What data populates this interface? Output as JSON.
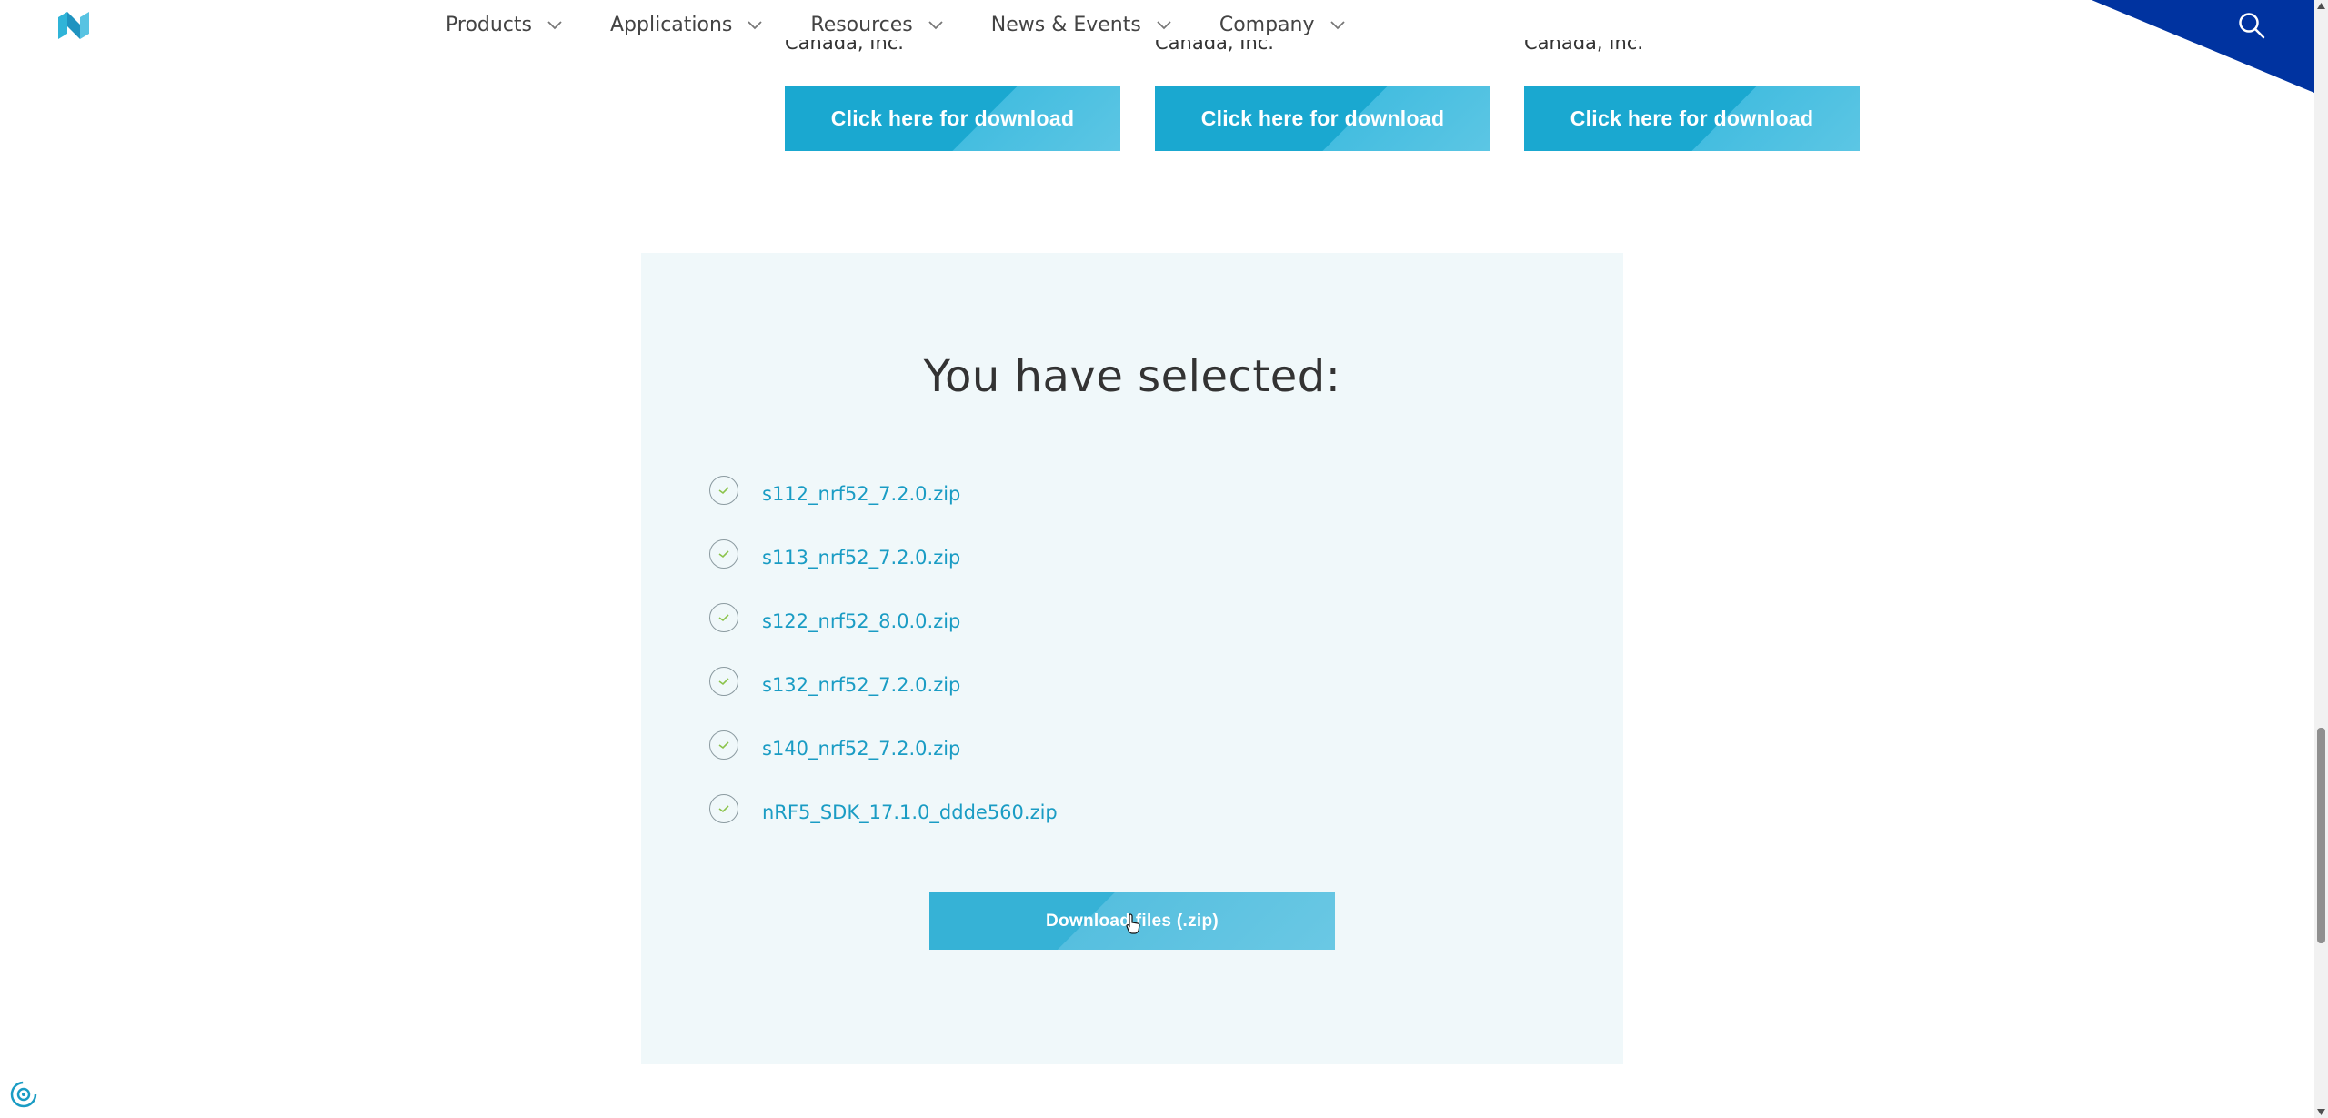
{
  "nav": {
    "items": [
      {
        "label": "Products"
      },
      {
        "label": "Applications"
      },
      {
        "label": "Resources"
      },
      {
        "label": "News & Events"
      },
      {
        "label": "Company"
      }
    ],
    "accent": "#0033a0"
  },
  "cards": [
    {
      "subtitle": "Canada, Inc.",
      "button": "Click here for download"
    },
    {
      "subtitle": "Canada, Inc.",
      "button": "Click here for download"
    },
    {
      "subtitle": "Canada, Inc.",
      "button": "Click here for download"
    }
  ],
  "selection": {
    "title": "You have selected:",
    "files": [
      "s112_nrf52_7.2.0.zip",
      "s113_nrf52_7.2.0.zip",
      "s122_nrf52_8.0.0.zip",
      "s132_nrf52_7.2.0.zip",
      "s140_nrf52_7.2.0.zip",
      "nRF5_SDK_17.1.0_ddde560.zip"
    ],
    "download_label": "Download files (.zip)"
  },
  "colors": {
    "primary": "#1aa8d0",
    "link": "#1a9cc4",
    "panel_bg": "#f0f8fa",
    "check": "#8bc34a"
  },
  "icons": {
    "search": "search-icon",
    "check": "check-circle-icon",
    "chevron": "chevron-down-icon",
    "cookie": "cookie-settings-icon"
  }
}
